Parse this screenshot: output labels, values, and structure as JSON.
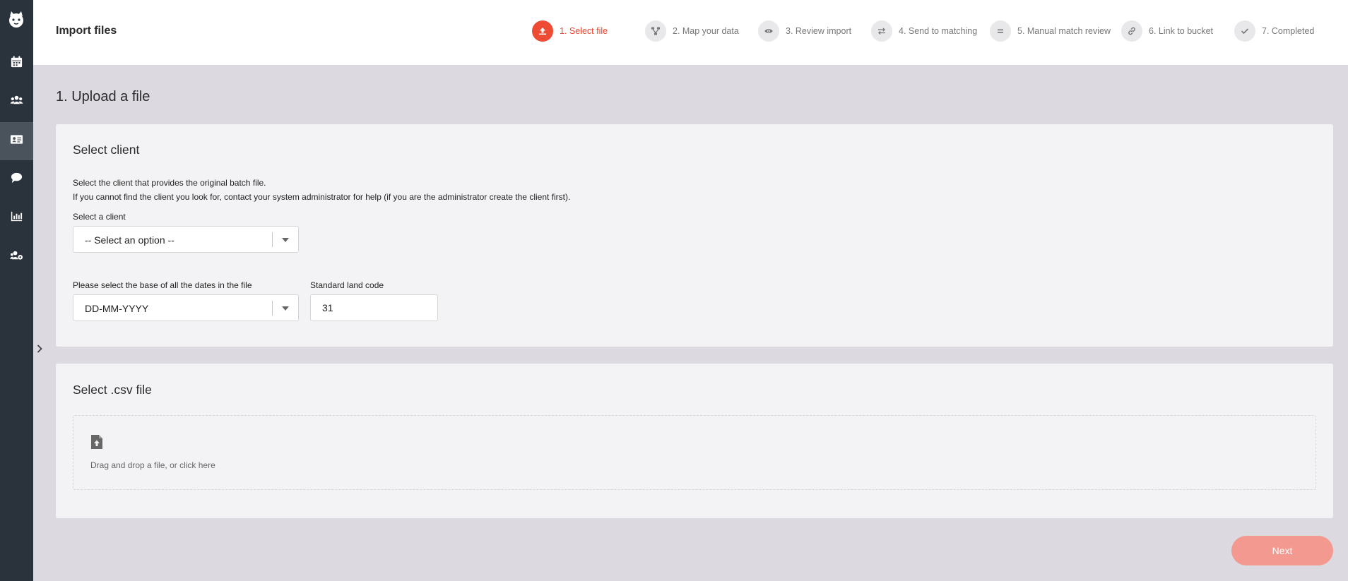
{
  "sidebar": {
    "logo": "cat-logo-icon",
    "items": [
      {
        "icon": "calendar-icon",
        "active": false
      },
      {
        "icon": "users-icon",
        "active": false
      },
      {
        "icon": "id-card-icon",
        "active": true
      },
      {
        "icon": "chat-bubble-icon",
        "active": false
      },
      {
        "icon": "bar-chart-icon",
        "active": false
      },
      {
        "icon": "users-settings-icon",
        "active": false
      }
    ]
  },
  "header": {
    "title": "Import files",
    "steps": [
      {
        "label": "1. Select file",
        "icon": "upload-icon",
        "active": true
      },
      {
        "label": "2. Map your data",
        "icon": "sitemap-icon",
        "active": false
      },
      {
        "label": "3. Review import",
        "icon": "eye-icon",
        "active": false
      },
      {
        "label": "4. Send to matching",
        "icon": "exchange-icon",
        "active": false
      },
      {
        "label": "5. Manual match review",
        "icon": "equals-icon",
        "active": false
      },
      {
        "label": "6. Link to bucket",
        "icon": "link-icon",
        "active": false
      },
      {
        "label": "7. Completed",
        "icon": "check-icon",
        "active": false
      }
    ]
  },
  "main": {
    "section_title": "1. Upload a file",
    "client_card": {
      "title": "Select client",
      "description_line1": "Select the client that provides the original batch file.",
      "description_line2": "If you cannot find the client you look for, contact your system administrator for help (if you are the administrator create the client first).",
      "client_label": "Select a client",
      "client_value": "-- Select an option --",
      "date_label": "Please select the base of all the dates in the file",
      "date_value": "DD-MM-YYYY",
      "land_code_label": "Standard land code",
      "land_code_value": "31"
    },
    "file_card": {
      "title": "Select .csv file",
      "dropzone_text": "Drag and drop a file, or click here",
      "dropzone_icon": "file-upload-icon"
    },
    "next_label": "Next"
  },
  "colors": {
    "sidebar_bg": "#2a323b",
    "accent": "#ee4b34",
    "next_button": "#f3998f",
    "page_bg": "#dcdae0"
  }
}
